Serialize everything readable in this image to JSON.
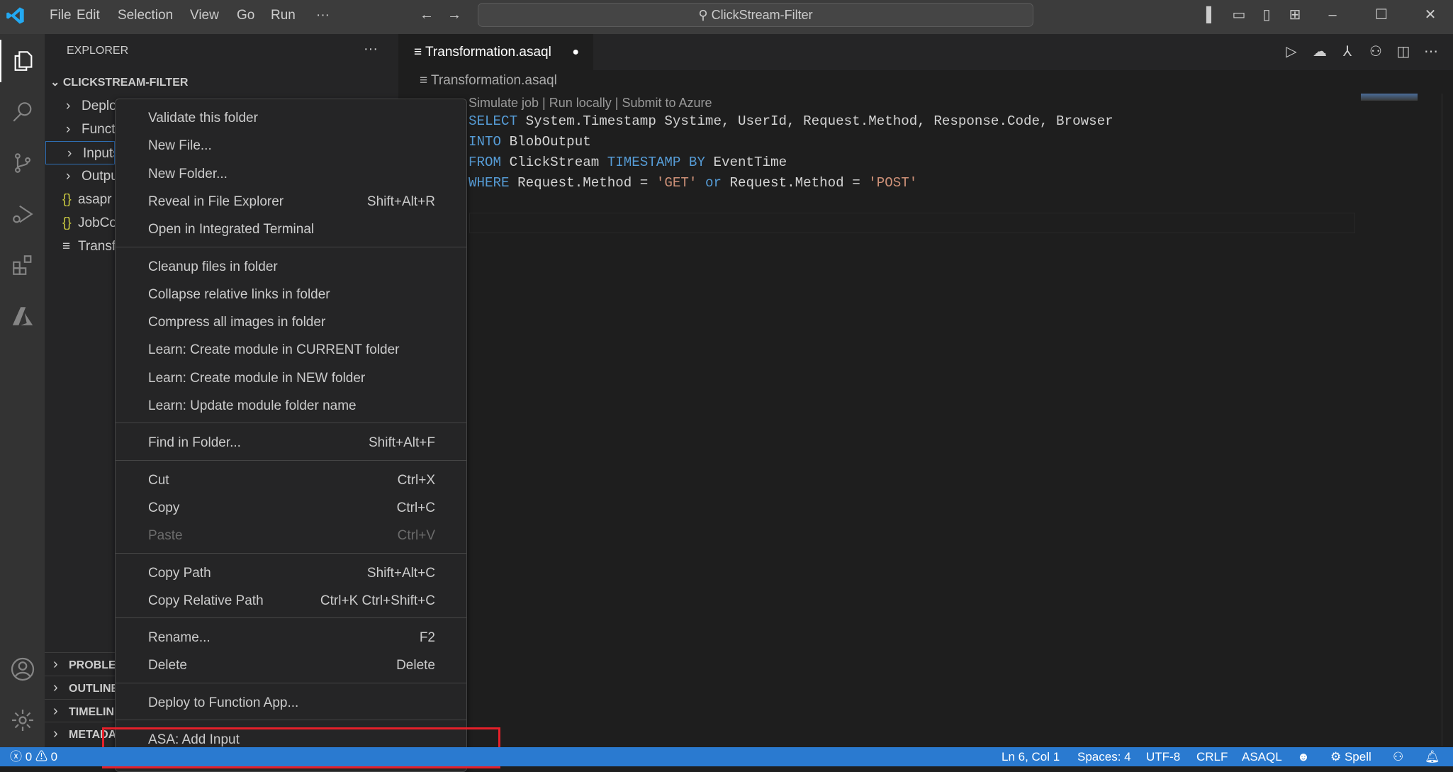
{
  "titlebar": {
    "menus": [
      "File",
      "Edit",
      "Selection",
      "View",
      "Go",
      "Run",
      "···"
    ],
    "search": "ClickStream-Filter"
  },
  "sidebar": {
    "title": "EXPLORER",
    "more": "···",
    "root": "CLICKSTREAM-FILTER",
    "items": [
      {
        "label": "Deplo",
        "type": "folder"
      },
      {
        "label": "Funct",
        "type": "folder"
      },
      {
        "label": "Inputs",
        "type": "folder",
        "selected": true
      },
      {
        "label": "Outpu",
        "type": "folder"
      },
      {
        "label": "asapr",
        "type": "json"
      },
      {
        "label": "JobCo",
        "type": "json"
      },
      {
        "label": "Transf",
        "type": "asaql"
      }
    ],
    "panels": [
      "PROBLEMS",
      "OUTLINE",
      "TIMELINE",
      "METADATA"
    ]
  },
  "editor": {
    "tab": "Transformation.asaql",
    "breadcrumb": "Transformation.asaql",
    "codelens": "Simulate job | Run locally | Submit to Azure",
    "lines": [
      [
        [
          "kw",
          "SELECT"
        ],
        [
          "t",
          " System.Timestamp Systime, UserId, Request.Method, Response.Code, Browser"
        ]
      ],
      [
        [
          "kw",
          "INTO"
        ],
        [
          "t",
          " BlobOutput"
        ]
      ],
      [
        [
          "kw",
          "FROM"
        ],
        [
          "t",
          " ClickStream "
        ],
        [
          "kw",
          "TIMESTAMP BY"
        ],
        [
          "t",
          " EventTime"
        ]
      ],
      [
        [
          "kw",
          "WHERE"
        ],
        [
          "t",
          " Request.Method = "
        ],
        [
          "str",
          "'GET'"
        ],
        [
          "t",
          " "
        ],
        [
          "kw",
          "or"
        ],
        [
          "t",
          " Request.Method = "
        ],
        [
          "str",
          "'POST'"
        ]
      ]
    ]
  },
  "context_menu": {
    "groups": [
      [
        {
          "label": "Validate this folder"
        },
        {
          "label": "New File..."
        },
        {
          "label": "New Folder..."
        },
        {
          "label": "Reveal in File Explorer",
          "shortcut": "Shift+Alt+R"
        },
        {
          "label": "Open in Integrated Terminal"
        }
      ],
      [
        {
          "label": "Cleanup files in folder"
        },
        {
          "label": "Collapse relative links in folder"
        },
        {
          "label": "Compress all images in folder"
        },
        {
          "label": "Learn: Create module in CURRENT folder"
        },
        {
          "label": "Learn: Create module in NEW folder"
        },
        {
          "label": "Learn: Update module folder name"
        }
      ],
      [
        {
          "label": "Find in Folder...",
          "shortcut": "Shift+Alt+F"
        }
      ],
      [
        {
          "label": "Cut",
          "shortcut": "Ctrl+X"
        },
        {
          "label": "Copy",
          "shortcut": "Ctrl+C"
        },
        {
          "label": "Paste",
          "shortcut": "Ctrl+V",
          "disabled": true
        }
      ],
      [
        {
          "label": "Copy Path",
          "shortcut": "Shift+Alt+C"
        },
        {
          "label": "Copy Relative Path",
          "shortcut": "Ctrl+K Ctrl+Shift+C"
        }
      ],
      [
        {
          "label": "Rename...",
          "shortcut": "F2"
        },
        {
          "label": "Delete",
          "shortcut": "Delete"
        }
      ],
      [
        {
          "label": "Deploy to Function App..."
        }
      ],
      [
        {
          "label": "ASA: Add Input",
          "highlighted": true
        }
      ]
    ]
  },
  "status": {
    "errors": "0",
    "warnings": "0",
    "position": "Ln 6, Col 1",
    "spaces": "Spaces: 4",
    "encoding": "UTF-8",
    "eol": "CRLF",
    "language": "ASAQL",
    "spell": "Spell"
  },
  "colors": {
    "status_bar": "#2a7ad0",
    "keyword": "#569cd6",
    "string": "#ce9178",
    "highlight_box": "#e5202a"
  }
}
